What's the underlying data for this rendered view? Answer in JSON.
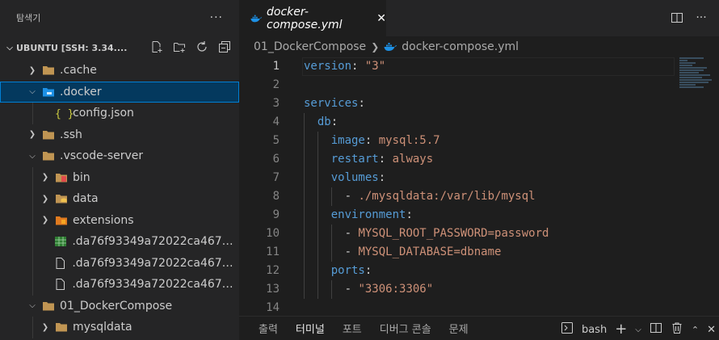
{
  "sidebar": {
    "title": "탐색기",
    "more": "···",
    "root": "UBUNTU [SSH: 3.34....",
    "items": [
      {
        "label": ".cache",
        "type": "folder",
        "depth": 0,
        "expanded": false
      },
      {
        "label": ".docker",
        "type": "folder-docker",
        "depth": 0,
        "expanded": true,
        "selected": true
      },
      {
        "label": "config.json",
        "type": "json",
        "depth": 1
      },
      {
        "label": ".ssh",
        "type": "folder",
        "depth": 0,
        "expanded": false
      },
      {
        "label": ".vscode-server",
        "type": "folder",
        "depth": 0,
        "expanded": true
      },
      {
        "label": "bin",
        "type": "folder-bin",
        "depth": 1,
        "expanded": false
      },
      {
        "label": "data",
        "type": "folder-data",
        "depth": 1,
        "expanded": false
      },
      {
        "label": "extensions",
        "type": "folder-ext",
        "depth": 1,
        "expanded": false
      },
      {
        "label": ".da76f93349a72022ca4670c...",
        "type": "sheet",
        "depth": 1
      },
      {
        "label": ".da76f93349a72022ca4670c...",
        "type": "file",
        "depth": 1
      },
      {
        "label": ".da76f93349a72022ca4670c...",
        "type": "file",
        "depth": 1
      },
      {
        "label": "01_DockerCompose",
        "type": "folder",
        "depth": 0,
        "expanded": true
      },
      {
        "label": "mysqldata",
        "type": "folder",
        "depth": 1,
        "expanded": false
      }
    ]
  },
  "editor": {
    "tab": "docker-compose.yml",
    "close": "✕",
    "breadcrumb": [
      "01_DockerCompose",
      "docker-compose.yml"
    ],
    "lines": [
      [
        {
          "c": "k",
          "t": "version"
        },
        {
          "c": "p",
          "t": ": "
        },
        {
          "c": "s",
          "t": "\"3\""
        }
      ],
      [],
      [
        {
          "c": "k",
          "t": "services"
        },
        {
          "c": "p",
          "t": ":"
        }
      ],
      [
        {
          "c": "p",
          "t": "  "
        },
        {
          "c": "k",
          "t": "db"
        },
        {
          "c": "p",
          "t": ":"
        }
      ],
      [
        {
          "c": "p",
          "t": "    "
        },
        {
          "c": "k",
          "t": "image"
        },
        {
          "c": "p",
          "t": ": "
        },
        {
          "c": "s",
          "t": "mysql:5.7"
        }
      ],
      [
        {
          "c": "p",
          "t": "    "
        },
        {
          "c": "k",
          "t": "restart"
        },
        {
          "c": "p",
          "t": ": "
        },
        {
          "c": "s",
          "t": "always"
        }
      ],
      [
        {
          "c": "p",
          "t": "    "
        },
        {
          "c": "k",
          "t": "volumes"
        },
        {
          "c": "p",
          "t": ":"
        }
      ],
      [
        {
          "c": "p",
          "t": "      - "
        },
        {
          "c": "s",
          "t": "./mysqldata:/var/lib/mysql"
        }
      ],
      [
        {
          "c": "p",
          "t": "    "
        },
        {
          "c": "k",
          "t": "environment"
        },
        {
          "c": "p",
          "t": ":"
        }
      ],
      [
        {
          "c": "p",
          "t": "      - "
        },
        {
          "c": "s",
          "t": "MYSQL_ROOT_PASSWORD=password"
        }
      ],
      [
        {
          "c": "p",
          "t": "      - "
        },
        {
          "c": "s",
          "t": "MYSQL_DATABASE=dbname"
        }
      ],
      [
        {
          "c": "p",
          "t": "    "
        },
        {
          "c": "k",
          "t": "ports"
        },
        {
          "c": "p",
          "t": ":"
        }
      ],
      [
        {
          "c": "p",
          "t": "      - "
        },
        {
          "c": "s",
          "t": "\"3306:3306\""
        }
      ],
      []
    ],
    "line_numbers": [
      "1",
      "2",
      "3",
      "4",
      "5",
      "6",
      "7",
      "8",
      "9",
      "10",
      "11",
      "12",
      "13",
      "14"
    ]
  },
  "panel": {
    "tabs": [
      "출력",
      "터미널",
      "포트",
      "디버그 콘솔",
      "문제"
    ],
    "active_tab": "터미널",
    "shell": "bash"
  },
  "colors": {
    "keyword": "#569cd6",
    "string": "#ce9178",
    "selection": "#04395e",
    "whale": "#1d91e6"
  }
}
